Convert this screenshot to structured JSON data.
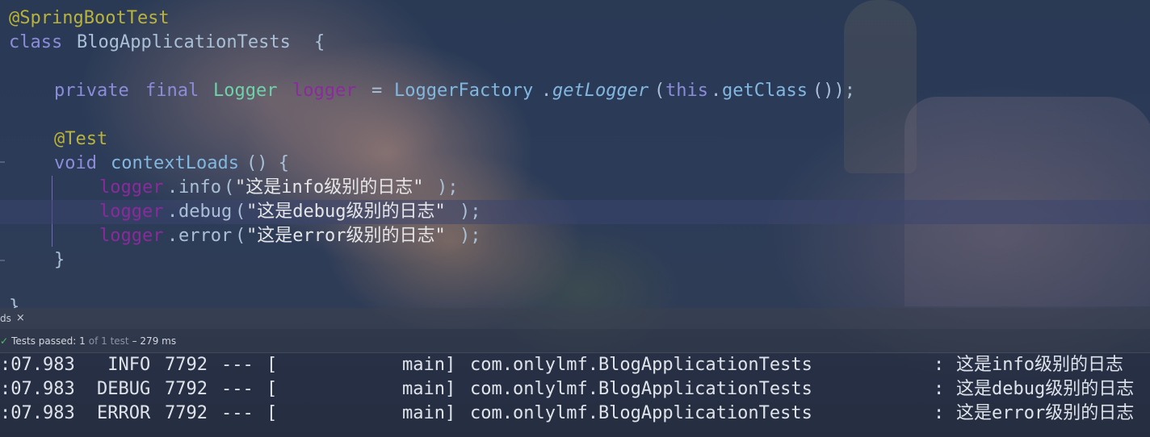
{
  "editor": {
    "line1_annotation": "@SpringBootTest",
    "line2": {
      "kw": "class",
      "name": "BlogApplicationTests",
      "brace": "{"
    },
    "line4": {
      "kw1": "private",
      "kw2": "final",
      "type": "Logger",
      "field": "logger",
      "eq": "=",
      "factory": "LoggerFactory",
      "dot": ".",
      "method": "getLogger",
      "open": "(",
      "this_kw": "this",
      "dot2": ".",
      "getclass": "getClass",
      "tail": "());"
    },
    "line6_annotation": "@Test",
    "line7": {
      "kw": "void",
      "name": "contextLoads",
      "rest": "() {"
    },
    "calls": [
      {
        "field": "logger",
        "dot": ".",
        "method": "info",
        "open": "(",
        "str": "\"这是info级别的日志\"",
        "close": ");"
      },
      {
        "field": "logger",
        "dot": ".",
        "method": "debug",
        "open": "(",
        "str": "\"这是debug级别的日志\"",
        "close": ");"
      },
      {
        "field": "logger",
        "dot": ".",
        "method": "error",
        "open": "(",
        "str": "\"这是error级别的日志\"",
        "close": ");"
      }
    ],
    "line11_close": "}",
    "line13_close": "}"
  },
  "run_panel": {
    "tab_label": "ds",
    "tab_close": "×",
    "status": {
      "passed": "Tests passed: 1",
      "of": "of 1 test",
      "time": "– 279 ms"
    }
  },
  "console": {
    "lines": [
      {
        "time": ":07.983",
        "level": " INFO",
        "pid": "7792",
        "sep": "---",
        "bracket": "[",
        "thread": "main]",
        "logger": "com.onlylmf.BlogApplicationTests",
        "colon": ":",
        "msg": "这是info级别的日志"
      },
      {
        "time": ":07.983",
        "level": "DEBUG",
        "pid": "7792",
        "sep": "---",
        "bracket": "[",
        "thread": "main]",
        "logger": "com.onlylmf.BlogApplicationTests",
        "colon": ":",
        "msg": "这是debug级别的日志"
      },
      {
        "time": ":07.983",
        "level": "ERROR",
        "pid": "7792",
        "sep": "---",
        "bracket": "[",
        "thread": "main]",
        "logger": "com.onlylmf.BlogApplicationTests",
        "colon": ":",
        "msg": "这是error级别的日志"
      }
    ]
  },
  "colors": {
    "annotation": "#b9b33c",
    "keyword": "#8c8cd9",
    "type": "#6fd2a8",
    "field": "#8a2a9c",
    "pass": "#59b96b"
  }
}
